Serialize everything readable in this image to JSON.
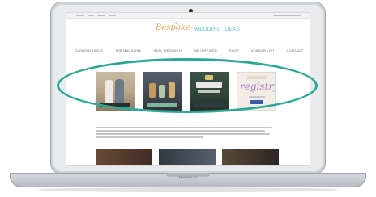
{
  "screen": {
    "site_logo": {
      "script_text": "Bespoke",
      "caps_text": "WEDDING IDEAS"
    },
    "nav": {
      "items": [
        {
          "label": "CURRENT ISSUE"
        },
        {
          "label": "THE MAGAZINE"
        },
        {
          "label": "REAL WEDDINGS"
        },
        {
          "label": "BE INSPIRED"
        },
        {
          "label": "SHOP"
        },
        {
          "label": "VENDOR LIST"
        },
        {
          "label": "CONTACT"
        }
      ]
    },
    "ad_banners": [
      {
        "name": "banner-couple"
      },
      {
        "name": "banner-drinks"
      },
      {
        "name": "banner-pearls"
      },
      {
        "name": "banner-registry",
        "script_text": "registry"
      }
    ]
  },
  "device": {
    "brand_label": "MacBook Air"
  },
  "colors": {
    "highlight_ring": "#2aa796",
    "logo_script": "#e7a25d",
    "logo_caps": "#5bbcc2",
    "registry_script": "#b47bc7"
  },
  "icons": {
    "menubar_apple": "apple-icon",
    "heart": "heart-icon"
  }
}
